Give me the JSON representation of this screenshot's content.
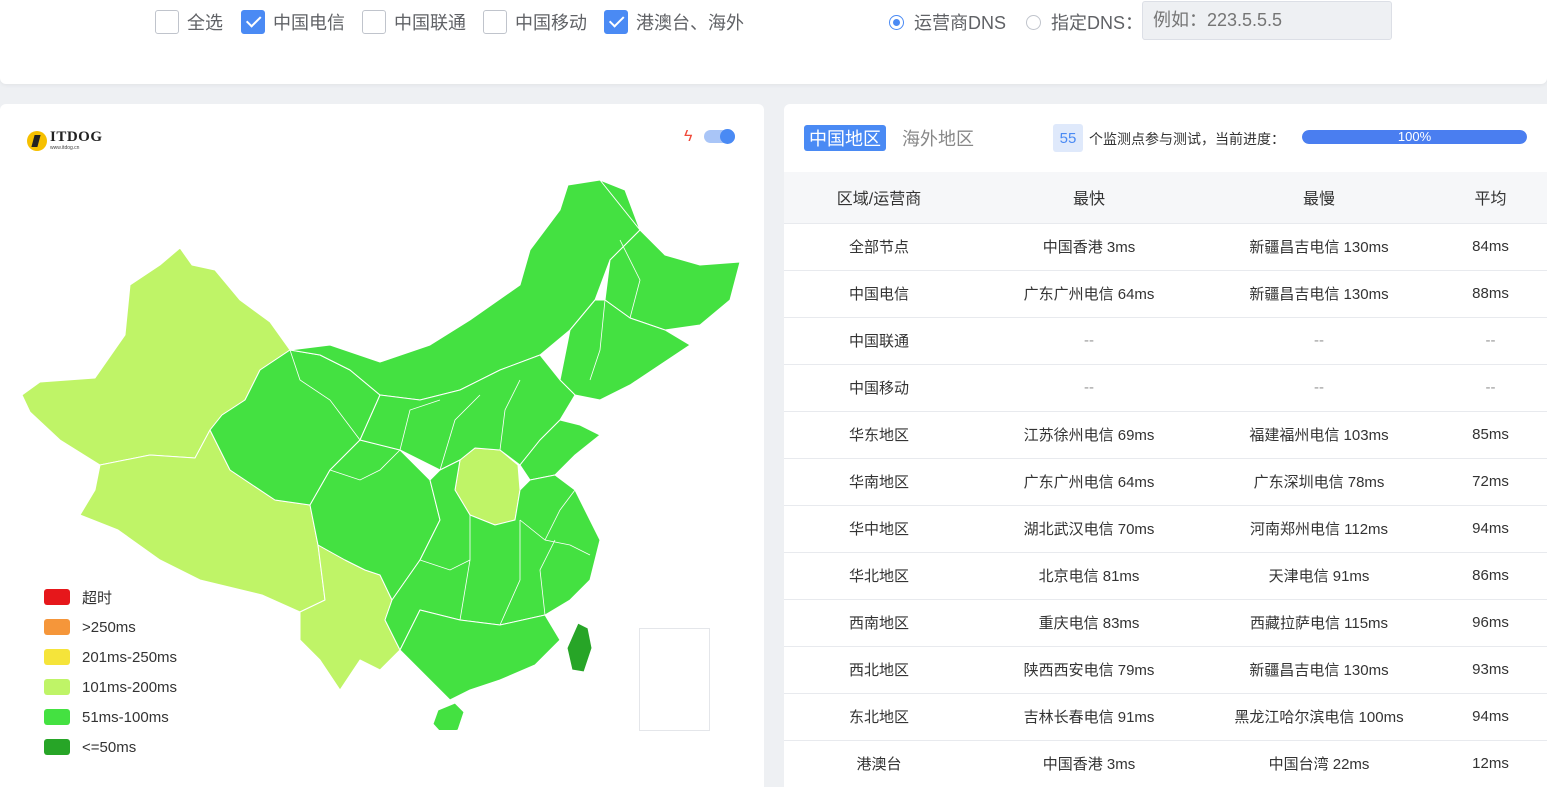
{
  "filters": {
    "checkboxes": [
      {
        "label": "全选",
        "checked": false
      },
      {
        "label": "中国电信",
        "checked": true
      },
      {
        "label": "中国联通",
        "checked": false
      },
      {
        "label": "中国移动",
        "checked": false
      },
      {
        "label": "港澳台、海外",
        "checked": true
      }
    ],
    "dns": {
      "options": [
        {
          "label": "运营商DNS",
          "selected": true
        },
        {
          "label": "指定DNS：",
          "selected": false
        }
      ],
      "placeholder": "例如：223.5.5.5"
    }
  },
  "map": {
    "logo_text": "ITDOG",
    "logo_sub": "www.itdog.cn",
    "bolt_icon": "lightning-icon",
    "legend": [
      {
        "label": "超时",
        "color": "#e6171b"
      },
      {
        "label": ">250ms",
        "color": "#f5963a"
      },
      {
        "label": "201ms-250ms",
        "color": "#f5e43a"
      },
      {
        "label": "101ms-200ms",
        "color": "#bff467"
      },
      {
        "label": "51ms-100ms",
        "color": "#44e141"
      },
      {
        "label": "<=50ms",
        "color": "#27a527"
      }
    ]
  },
  "results": {
    "tabs": [
      {
        "label": "中国地区",
        "active": true
      },
      {
        "label": "海外地区",
        "active": false
      }
    ],
    "node_count": "55",
    "progress_label": "个监测点参与测试，当前进度：",
    "progress_value": 100,
    "progress_text": "100%",
    "columns": [
      "区域/运营商",
      "最快",
      "最慢",
      "平均"
    ],
    "rows": [
      [
        "全部节点",
        "中国香港 3ms",
        "新疆昌吉电信 130ms",
        "84ms"
      ],
      [
        "中国电信",
        "广东广州电信 64ms",
        "新疆昌吉电信 130ms",
        "88ms"
      ],
      [
        "中国联通",
        "--",
        "--",
        "--"
      ],
      [
        "中国移动",
        "--",
        "--",
        "--"
      ],
      [
        "华东地区",
        "江苏徐州电信 69ms",
        "福建福州电信 103ms",
        "85ms"
      ],
      [
        "华南地区",
        "广东广州电信 64ms",
        "广东深圳电信 78ms",
        "72ms"
      ],
      [
        "华中地区",
        "湖北武汉电信 70ms",
        "河南郑州电信 112ms",
        "94ms"
      ],
      [
        "华北地区",
        "北京电信 81ms",
        "天津电信 91ms",
        "86ms"
      ],
      [
        "西南地区",
        "重庆电信 83ms",
        "西藏拉萨电信 115ms",
        "96ms"
      ],
      [
        "西北地区",
        "陕西西安电信 79ms",
        "新疆昌吉电信 130ms",
        "93ms"
      ],
      [
        "东北地区",
        "吉林长春电信 91ms",
        "黑龙江哈尔滨电信 100ms",
        "94ms"
      ],
      [
        "港澳台",
        "中国香港 3ms",
        "中国台湾 22ms",
        "12ms"
      ]
    ]
  }
}
